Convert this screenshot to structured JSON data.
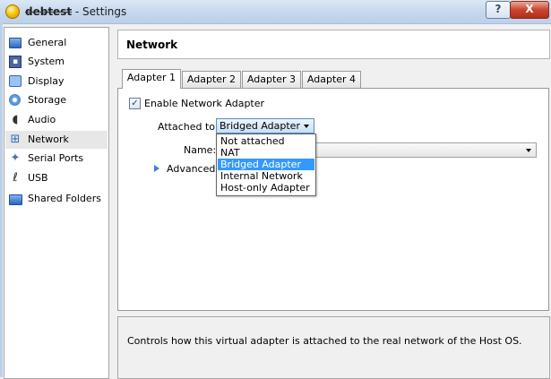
{
  "window": {
    "title_name": "debtest",
    "title_suffix": " - Settings",
    "help_label": "?",
    "close_label": "X"
  },
  "sidebar": {
    "items": [
      {
        "label": "General",
        "icon": "general-icon"
      },
      {
        "label": "System",
        "icon": "system-icon"
      },
      {
        "label": "Display",
        "icon": "display-icon"
      },
      {
        "label": "Storage",
        "icon": "storage-icon"
      },
      {
        "label": "Audio",
        "icon": "audio-icon"
      },
      {
        "label": "Network",
        "icon": "network-icon",
        "selected": true
      },
      {
        "label": "Serial Ports",
        "icon": "serial-ports-icon"
      },
      {
        "label": "USB",
        "icon": "usb-icon"
      },
      {
        "label": "Shared Folders",
        "icon": "shared-folders-icon"
      }
    ]
  },
  "main": {
    "section_title": "Network",
    "tabs": [
      {
        "label": "Adapter 1",
        "active": true
      },
      {
        "label": "Adapter 2"
      },
      {
        "label": "Adapter 3"
      },
      {
        "label": "Adapter 4"
      }
    ],
    "enable_adapter": {
      "label": "Enable Network Adapter",
      "checked": true,
      "check_glyph": "✓"
    },
    "attached_to": {
      "label": "Attached to:",
      "value": "Bridged Adapter"
    },
    "name_field": {
      "label": "Name:",
      "value": ""
    },
    "advanced_label": "Advanced",
    "dropdown_options": [
      "Not attached",
      "NAT",
      "Bridged Adapter",
      "Internal Network",
      "Host-only Adapter"
    ],
    "dropdown_selected_index": 2,
    "description": "Controls how this virtual adapter is attached to the real network of the Host OS."
  },
  "colors": {
    "selection": "#3399ff",
    "combo_accent": "#5b8cc8"
  }
}
